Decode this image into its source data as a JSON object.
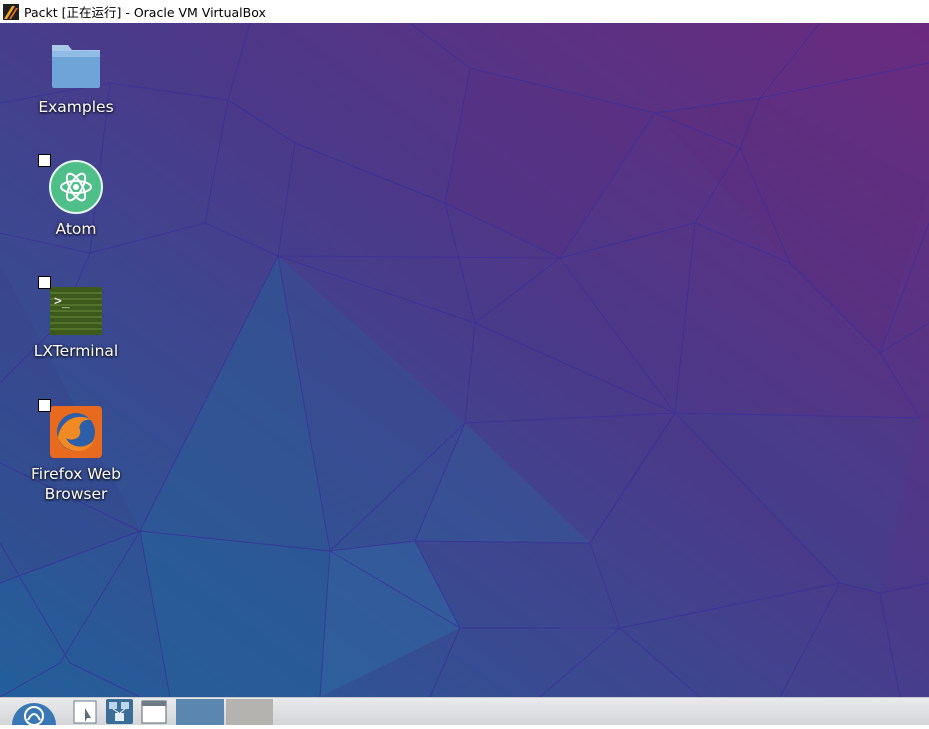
{
  "window": {
    "title": "Packt [正在运行] - Oracle VM VirtualBox",
    "app_icon": "virtualbox-icon"
  },
  "desktop": {
    "icons": [
      {
        "label": "Examples",
        "icon": "folder-icon",
        "shortcut": false
      },
      {
        "label": "Atom",
        "icon": "atom-icon",
        "shortcut": true
      },
      {
        "label": "LXTerminal",
        "icon": "terminal-icon",
        "shortcut": true
      },
      {
        "label": "Firefox Web\nBrowser",
        "icon": "firefox-icon",
        "shortcut": true
      }
    ]
  },
  "taskbar": {
    "items": [
      {
        "icon": "lubuntu-menu-icon"
      },
      {
        "icon": "file-manager-icon"
      },
      {
        "icon": "network-icon"
      },
      {
        "icon": "window-icon"
      },
      {
        "icon": "workspace-1"
      },
      {
        "icon": "workspace-2"
      }
    ]
  },
  "colors": {
    "wallpaper_top": "#5a2a7a",
    "wallpaper_bottom": "#2a5a95",
    "taskbar": "#dcdee1"
  }
}
